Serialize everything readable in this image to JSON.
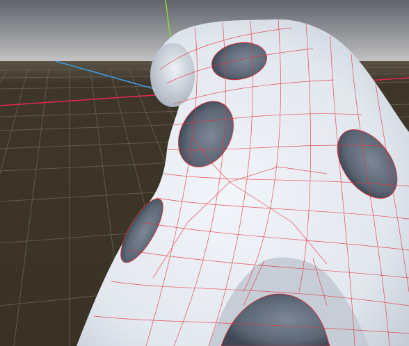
{
  "viewport": {
    "colors": {
      "sky_top": "#5f636b",
      "sky_horizon": "#c6c6c6",
      "ground": "#3b3326",
      "grid_line": "#6a6355",
      "axis_x": "#e0284a",
      "axis_y": "#8fd43a",
      "axis_z": "#3a9be8",
      "mesh_fill": "#e6ebf1",
      "mesh_shade": "#b8c0cc",
      "mesh_hole": "#5f6a78",
      "wireframe": "#e1323c"
    }
  }
}
